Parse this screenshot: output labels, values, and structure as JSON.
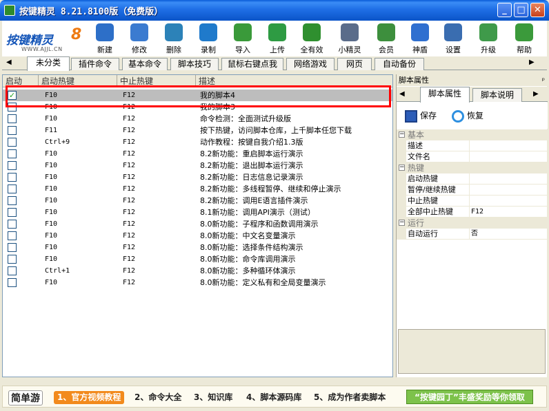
{
  "window": {
    "title": "按键精灵 8.21.8100版（免费版）",
    "min_label": "_",
    "max_label": "□",
    "close_label": "✕"
  },
  "logo": {
    "name": "按键精灵",
    "version": "8",
    "url": "WWW.AJJL.CN"
  },
  "toolbar": [
    {
      "label": "新建",
      "icon": "new-doc-icon",
      "color": "#2D6FC8"
    },
    {
      "label": "修改",
      "icon": "edit-doc-icon",
      "color": "#3B7BD0"
    },
    {
      "label": "删除",
      "icon": "trash-icon",
      "color": "#2C82B8"
    },
    {
      "label": "录制",
      "icon": "video-camera-icon",
      "color": "#1F7ACB"
    },
    {
      "label": "导入",
      "icon": "import-icon",
      "color": "#3A9A3A"
    },
    {
      "label": "上传",
      "icon": "upload-icon",
      "color": "#2E9B43"
    },
    {
      "label": "全有效",
      "icon": "check-all-icon",
      "color": "#2F8F2F"
    },
    {
      "label": "小精灵",
      "icon": "sprite-icon",
      "color": "#5A6C8A"
    },
    {
      "label": "会员",
      "icon": "member-icon",
      "color": "#3D8F3D"
    },
    {
      "label": "神盾",
      "icon": "shield-icon",
      "color": "#2F6FD0"
    },
    {
      "label": "设置",
      "icon": "gear-icon",
      "color": "#3A6DB0"
    },
    {
      "label": "升级",
      "icon": "upgrade-icon",
      "color": "#3F9A4A"
    },
    {
      "label": "帮助",
      "icon": "help-icon",
      "color": "#3B9A3B"
    }
  ],
  "tabs": [
    "未分类",
    "插件命令",
    "基本命令",
    "脚本技巧",
    "鼠标右键点我",
    "网络游戏",
    "网页",
    "自动备份"
  ],
  "active_tab": "未分类",
  "list": {
    "columns": [
      "启动",
      "启动热键",
      "中止热键",
      "描述"
    ],
    "rows": [
      {
        "checked": true,
        "start": "F10",
        "stop": "F12",
        "desc": "我的脚本4",
        "selected": true
      },
      {
        "checked": false,
        "start": "F10",
        "stop": "F12",
        "desc": "我的脚本3",
        "selected": false
      },
      {
        "checked": false,
        "start": "F10",
        "stop": "F12",
        "desc": "命令检测：全面测试升级版",
        "selected": false
      },
      {
        "checked": false,
        "start": "F11",
        "stop": "F12",
        "desc": "按下热键，访问脚本仓库，上千脚本任您下载",
        "selected": false
      },
      {
        "checked": false,
        "start": "Ctrl+9",
        "stop": "F12",
        "desc": "动作教程：按键自我介绍1.3版",
        "selected": false
      },
      {
        "checked": false,
        "start": "F10",
        "stop": "F12",
        "desc": "8.2新功能：重启脚本运行演示",
        "selected": false
      },
      {
        "checked": false,
        "start": "F10",
        "stop": "F12",
        "desc": "8.2新功能：退出脚本运行演示",
        "selected": false
      },
      {
        "checked": false,
        "start": "F10",
        "stop": "F12",
        "desc": "8.2新功能：日志信息记录演示",
        "selected": false
      },
      {
        "checked": false,
        "start": "F10",
        "stop": "F12",
        "desc": "8.2新功能：多线程暂停、继续和停止演示",
        "selected": false
      },
      {
        "checked": false,
        "start": "F10",
        "stop": "F12",
        "desc": "8.2新功能：调用E语言插件演示",
        "selected": false
      },
      {
        "checked": false,
        "start": "F10",
        "stop": "F12",
        "desc": "8.1新功能：调用API演示（测试）",
        "selected": false
      },
      {
        "checked": false,
        "start": "F10",
        "stop": "F12",
        "desc": "8.0新功能：子程序和函数调用演示",
        "selected": false
      },
      {
        "checked": false,
        "start": "F10",
        "stop": "F12",
        "desc": "8.0新功能：中文名变量演示",
        "selected": false
      },
      {
        "checked": false,
        "start": "F10",
        "stop": "F12",
        "desc": "8.0新功能：选择条件结构演示",
        "selected": false
      },
      {
        "checked": false,
        "start": "F10",
        "stop": "F12",
        "desc": "8.0新功能：命令库调用演示",
        "selected": false
      },
      {
        "checked": false,
        "start": "Ctrl+1",
        "stop": "F12",
        "desc": "8.0新功能：多种循环体演示",
        "selected": false
      },
      {
        "checked": false,
        "start": "F10",
        "stop": "F12",
        "desc": "8.0新功能：定义私有和全局变量演示",
        "selected": false
      }
    ]
  },
  "props": {
    "panel_title": "脚本属性",
    "tabs": [
      "脚本属性",
      "脚本说明"
    ],
    "save_label": "保存",
    "restore_label": "恢复",
    "groups": [
      {
        "name": "基本",
        "items": [
          {
            "k": "描述",
            "v": ""
          },
          {
            "k": "文件名",
            "v": ""
          }
        ]
      },
      {
        "name": "热键",
        "items": [
          {
            "k": "启动热键",
            "v": ""
          },
          {
            "k": "暂停/继续热键",
            "v": ""
          },
          {
            "k": "中止热键",
            "v": ""
          },
          {
            "k": "全部中止热键",
            "v": "F12"
          }
        ]
      },
      {
        "name": "运行",
        "items": [
          {
            "k": "自动运行",
            "v": "否"
          }
        ]
      }
    ]
  },
  "bottom": {
    "brand": "简单游",
    "steps": [
      "1、官方视频教程",
      "2、命令大全",
      "3、知识库",
      "4、脚本源码库",
      "5、成为作者卖脚本"
    ],
    "promo": "“按键园丁”丰盛奖励等你领取"
  }
}
